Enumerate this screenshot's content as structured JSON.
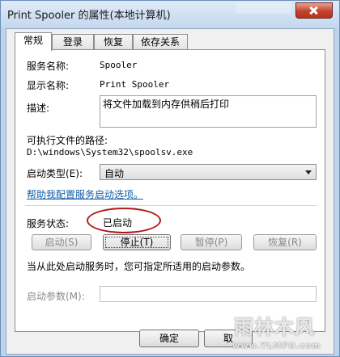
{
  "window": {
    "title": "Print Spooler 的属性(本地计算机)"
  },
  "tabs": [
    {
      "label": "常规"
    },
    {
      "label": "登录"
    },
    {
      "label": "恢复"
    },
    {
      "label": "依存关系"
    }
  ],
  "general": {
    "service_name_label": "服务名称:",
    "service_name_value": "Spooler",
    "display_name_label": "显示名称:",
    "display_name_value": "Print Spooler",
    "description_label": "描述:",
    "description_value": "将文件加载到内存供稍后打印",
    "path_label": "可执行文件的路径:",
    "path_value": "D:\\windows\\System32\\spoolsv.exe",
    "startup_type_label": "启动类型(E):",
    "startup_type_value": "自动",
    "help_link": "帮助我配置服务启动选项。",
    "status_label": "服务状态:",
    "status_value": "已启动",
    "buttons": {
      "start": "启动(S)",
      "stop": "停止(T)",
      "pause": "暂停(P)",
      "resume": "恢复(R)"
    },
    "hint": "当从此处启动服务时，您可指定所适用的启动参数。",
    "start_params_label": "启动参数(M):",
    "start_params_value": ""
  },
  "dialog_buttons": {
    "ok": "确定",
    "cancel": "取"
  },
  "watermark": {
    "text": "雨林木风",
    "url": "www.YLMFU.com"
  },
  "colors": {
    "highlight_ellipse": "#b3191c",
    "link": "#0f5ea8",
    "close_button": "#c4412b"
  }
}
